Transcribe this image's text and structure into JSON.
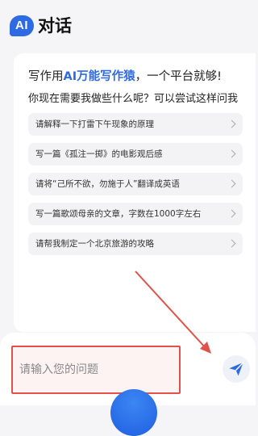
{
  "header": {
    "logo_text": "AI",
    "title": "对话"
  },
  "card": {
    "headline_prefix": "写作用",
    "headline_brand": "AI万能写作猿",
    "headline_suffix": "，一个平台就够!",
    "subtitle": "你现在需要我做些什么呢？可以尝试这样问我",
    "suggestions": [
      "请解释一下打雷下午现象的原理",
      "写一篇《孤注一掷》的电影观后感",
      "请将“己所不欲，勿施于人”翻译成英语",
      "写一篇歌颂母亲的文章，字数在1000字左右",
      "请帮我制定一个北京旅游的攻略"
    ]
  },
  "input": {
    "placeholder": "请输入您的问题"
  },
  "icons": {
    "send": "send-icon",
    "chevron": "chevron-right-icon"
  },
  "colors": {
    "brand_blue": "#2f6ae5",
    "annotation_red": "#e2524a"
  }
}
